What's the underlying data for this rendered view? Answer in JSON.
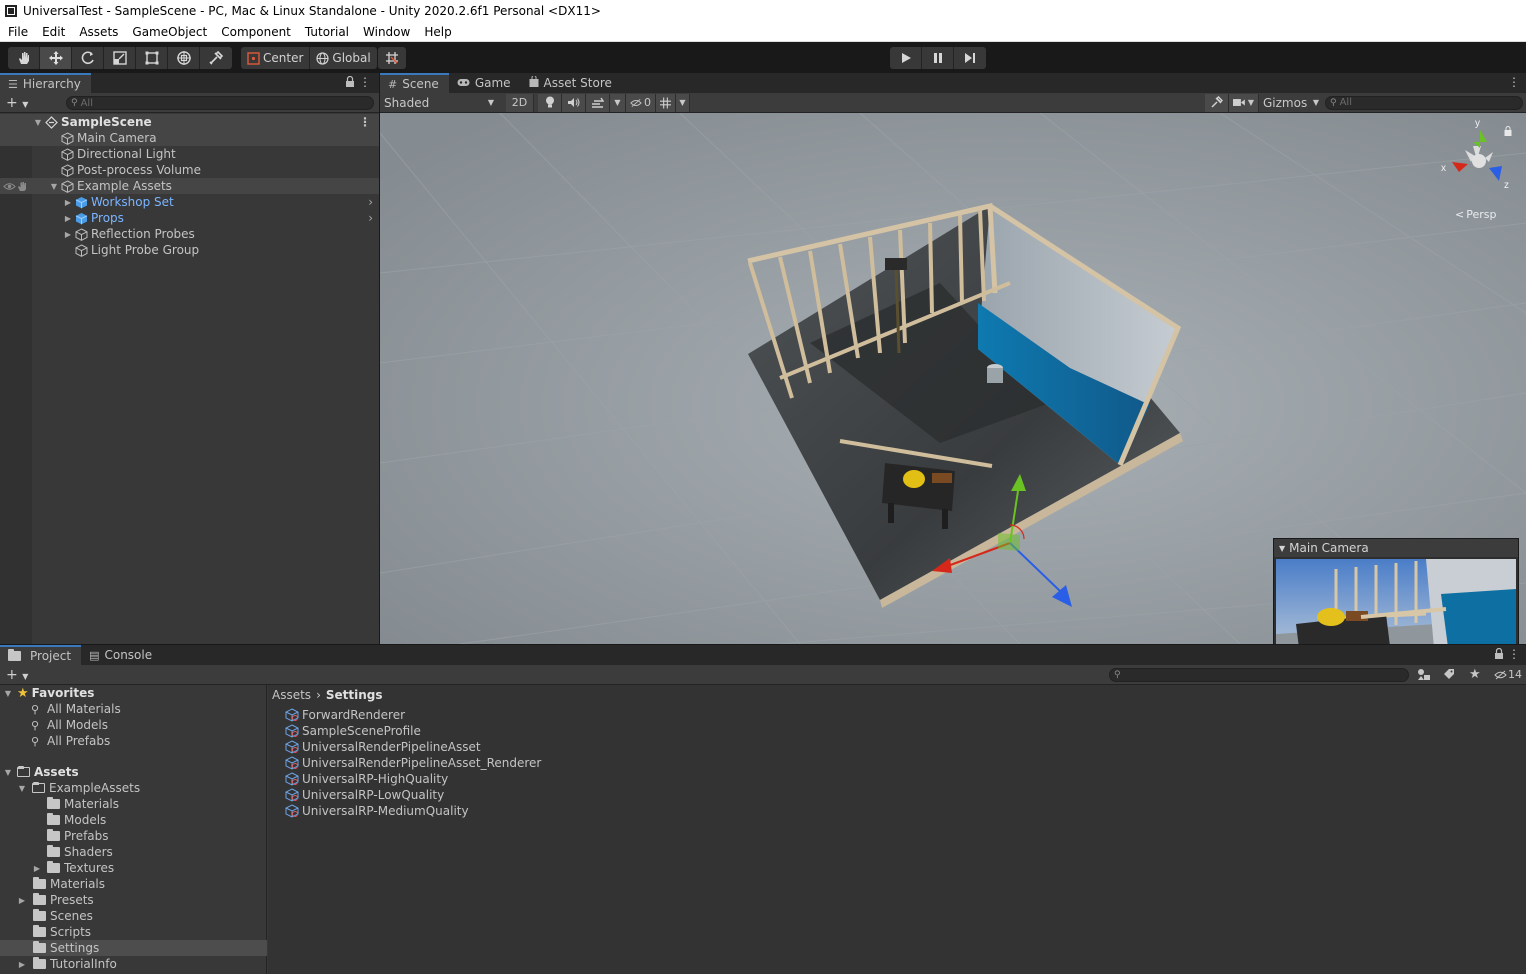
{
  "window": {
    "title": "UniversalTest - SampleScene - PC, Mac & Linux Standalone - Unity 2020.2.6f1 Personal <DX11>"
  },
  "menu": [
    "File",
    "Edit",
    "Assets",
    "GameObject",
    "Component",
    "Tutorial",
    "Window",
    "Help"
  ],
  "toolbar": {
    "pivot_label": "Center",
    "space_label": "Global"
  },
  "hierarchy": {
    "tab": "Hierarchy",
    "search_placeholder": "All",
    "scene": "SampleScene",
    "items": [
      {
        "label": "Main Camera"
      },
      {
        "label": "Directional Light"
      },
      {
        "label": "Post-process Volume"
      },
      {
        "label": "Example Assets"
      },
      {
        "label": "Workshop Set"
      },
      {
        "label": "Props"
      },
      {
        "label": "Reflection Probes"
      },
      {
        "label": "Light Probe Group"
      }
    ]
  },
  "scene": {
    "tabs": [
      "Scene",
      "Game",
      "Asset Store"
    ],
    "draw_mode": "Shaded",
    "mode_2d": "2D",
    "hidden_count": "0",
    "gizmos": "Gizmos",
    "search_placeholder": "All",
    "orientation": {
      "y": "y",
      "x": "x",
      "z": "z",
      "persp": "Persp"
    },
    "camera_preview_title": "Main Camera"
  },
  "project": {
    "tabs": [
      "Project",
      "Console"
    ],
    "hidden_count": "14",
    "favorites_label": "Favorites",
    "favorites": [
      "All Materials",
      "All Models",
      "All Prefabs"
    ],
    "assets_label": "Assets",
    "tree": [
      {
        "label": "ExampleAssets"
      },
      {
        "label": "Materials"
      },
      {
        "label": "Models"
      },
      {
        "label": "Prefabs"
      },
      {
        "label": "Shaders"
      },
      {
        "label": "Textures"
      },
      {
        "label": "Materials"
      },
      {
        "label": "Presets"
      },
      {
        "label": "Scenes"
      },
      {
        "label": "Scripts"
      },
      {
        "label": "Settings"
      },
      {
        "label": "TutorialInfo"
      }
    ],
    "breadcrumb": [
      "Assets",
      "Settings"
    ],
    "files": [
      "ForwardRenderer",
      "SampleSceneProfile",
      "UniversalRenderPipelineAsset",
      "UniversalRenderPipelineAsset_Renderer",
      "UniversalRP-HighQuality",
      "UniversalRP-LowQuality",
      "UniversalRP-MediumQuality"
    ]
  },
  "colors": {
    "accent": "#3a79bb",
    "prefab_text": "#7cb4ff",
    "gizmo_x": "#d6281a",
    "gizmo_y": "#6ac223",
    "gizmo_z": "#2a5ee6"
  }
}
